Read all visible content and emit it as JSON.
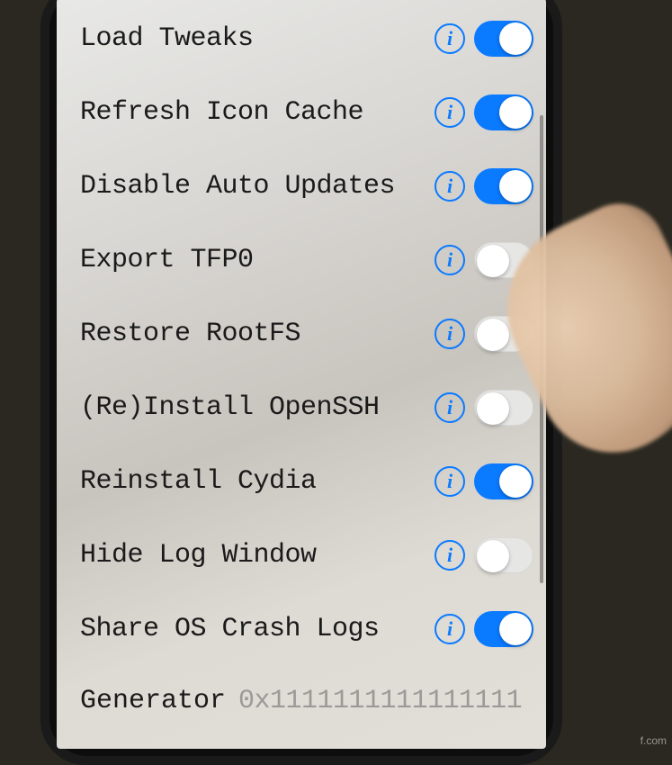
{
  "settings": [
    {
      "id": "load-tweaks",
      "label": "Load Tweaks",
      "info": true,
      "toggle": true
    },
    {
      "id": "refresh-icon-cache",
      "label": "Refresh Icon Cache",
      "info": true,
      "toggle": true
    },
    {
      "id": "disable-auto-updates",
      "label": "Disable Auto Updates",
      "info": true,
      "toggle": true
    },
    {
      "id": "export-tfp0",
      "label": "Export TFP0",
      "info": true,
      "toggle": false
    },
    {
      "id": "restore-rootfs",
      "label": "Restore RootFS",
      "info": true,
      "toggle": false
    },
    {
      "id": "reinstall-openssh",
      "label": "(Re)Install OpenSSH",
      "info": true,
      "toggle": false
    },
    {
      "id": "reinstall-cydia",
      "label": "Reinstall Cydia",
      "info": true,
      "toggle": true
    },
    {
      "id": "hide-log-window",
      "label": "Hide Log Window",
      "info": true,
      "toggle": false
    },
    {
      "id": "share-os-crash-logs",
      "label": "Share OS Crash Logs",
      "info": true,
      "toggle": true
    }
  ],
  "generator": {
    "label": "Generator",
    "value": "0x1111111111111111"
  },
  "info_glyph": "i",
  "watermark": "f.com"
}
